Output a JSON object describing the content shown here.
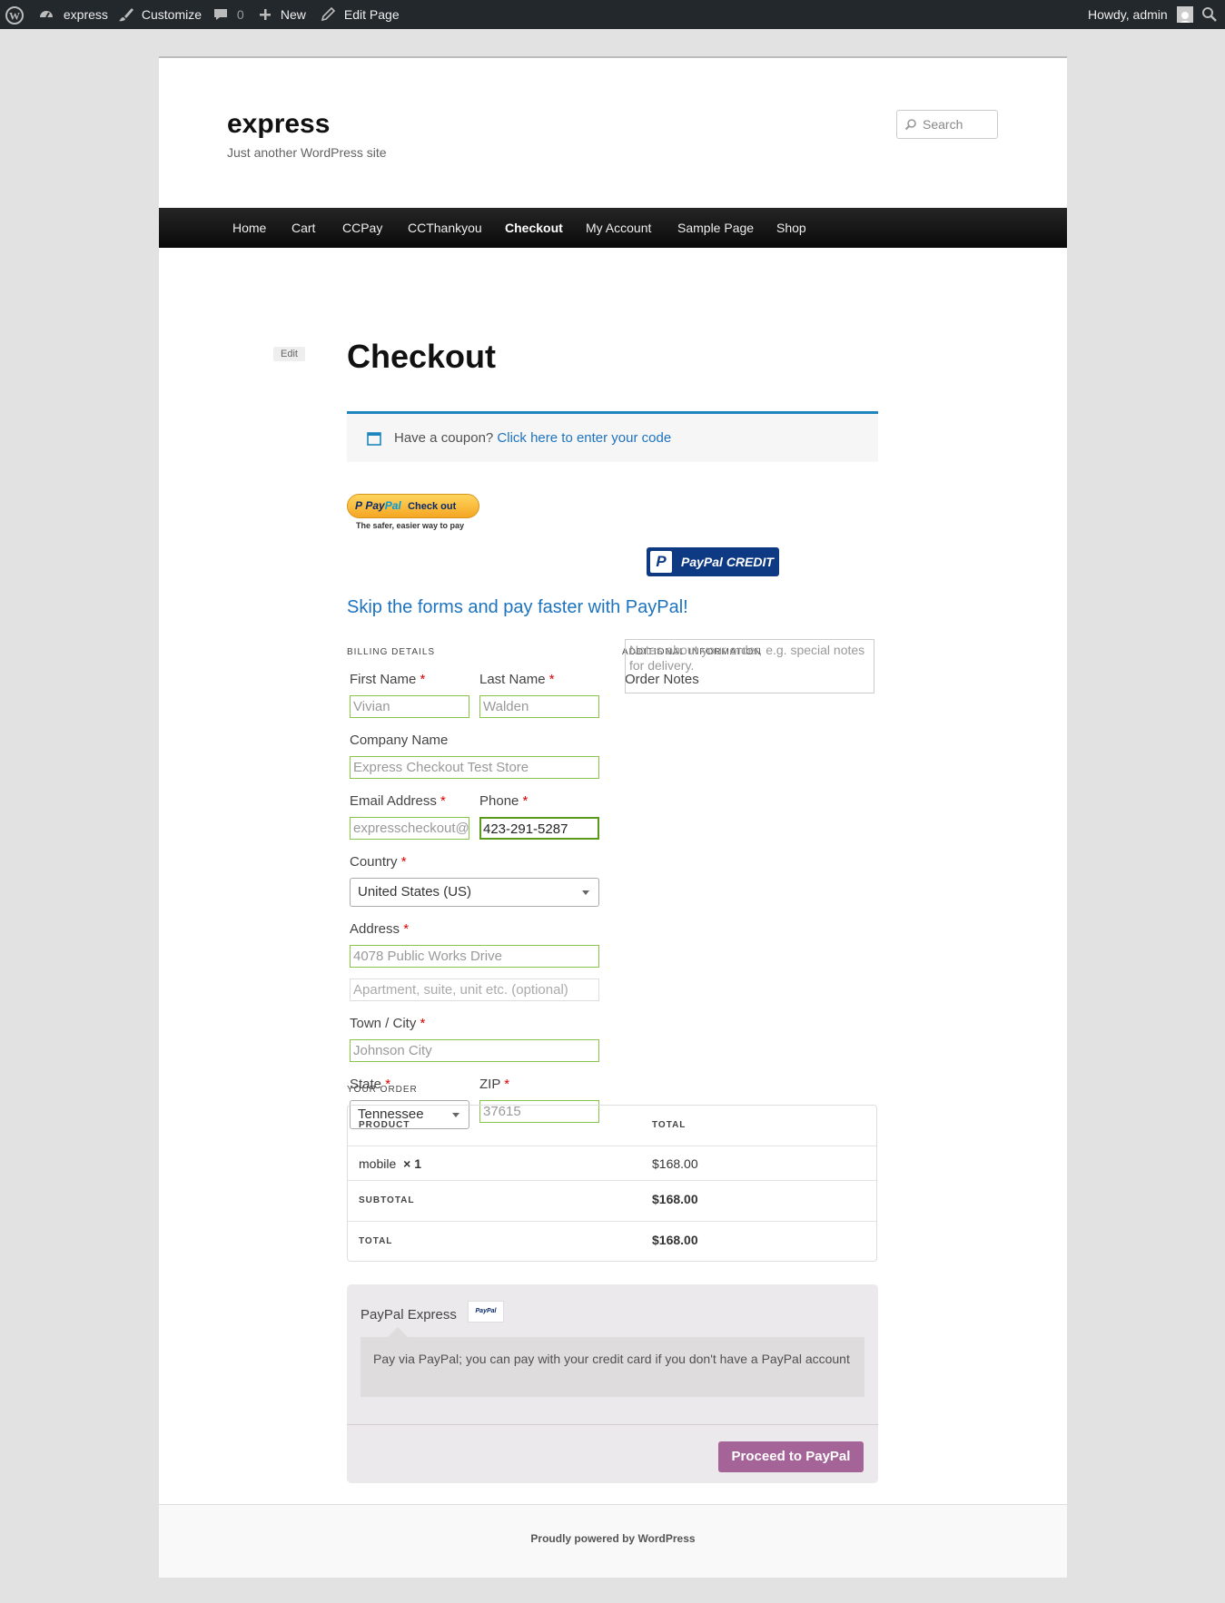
{
  "admin_bar": {
    "site_name": "express",
    "customize": "Customize",
    "comments_count": "0",
    "new": "New",
    "edit_page": "Edit Page",
    "howdy": "Howdy, admin"
  },
  "site": {
    "title": "express",
    "tagline": "Just another WordPress site",
    "search_placeholder": "Search"
  },
  "nav": {
    "items": [
      "Home",
      "Cart",
      "CCPay",
      "CCThankyou",
      "Checkout",
      "My Account",
      "Sample Page",
      "Shop"
    ],
    "active": "Checkout"
  },
  "page": {
    "edit_label": "Edit",
    "title": "Checkout"
  },
  "coupon": {
    "prompt": "Have a coupon?",
    "link": "Click here to enter your code"
  },
  "paypal_buttons": {
    "checkout_pay": "Pay",
    "checkout_pal": "Pal",
    "checkout_label": "Check out",
    "checkout_sub": "The safer, easier way to pay",
    "credit_mark": "P",
    "credit_label": "PayPal CREDIT"
  },
  "skip_text": "Skip the forms and pay faster with PayPal!",
  "billing": {
    "section_title": "Billing Details",
    "first_name": {
      "label": "First Name",
      "value": "Vivian"
    },
    "last_name": {
      "label": "Last Name",
      "value": "Walden"
    },
    "company": {
      "label": "Company Name",
      "value": "Express Checkout Test Store"
    },
    "email": {
      "label": "Email Address",
      "value": "expresscheckout@"
    },
    "phone": {
      "label": "Phone",
      "value": "423-291-5287"
    },
    "country": {
      "label": "Country",
      "value": "United States (US)"
    },
    "address": {
      "label": "Address",
      "value": "4078 Public Works Drive",
      "placeholder2": "Apartment, suite, unit etc. (optional)"
    },
    "city": {
      "label": "Town / City",
      "value": "Johnson City"
    },
    "state": {
      "label": "State",
      "value": "Tennessee"
    },
    "zip": {
      "label": "ZIP",
      "value": "37615"
    },
    "required_mark": "*"
  },
  "additional": {
    "section_title": "Additional Information",
    "notes_label": "Order Notes",
    "notes_placeholder": "Notes about your order, e.g. special notes for delivery."
  },
  "order": {
    "section_title": "Your Order",
    "col_product": "PRODUCT",
    "col_total": "TOTAL",
    "item_name": "mobile",
    "item_qty": "× 1",
    "item_total": "$168.00",
    "subtotal_label": "SUBTOTAL",
    "subtotal": "$168.00",
    "total_label": "TOTAL",
    "total": "$168.00"
  },
  "payment": {
    "method": "PayPal Express",
    "logo_text": "PayPal",
    "description": "Pay via PayPal; you can pay with your credit card if you don't have a PayPal account",
    "button": "Proceed to PayPal"
  },
  "footer": {
    "powered": "Proudly powered by WordPress"
  },
  "colors": {
    "adminbar": "#23282d",
    "link": "#1e73be",
    "button": "#a46497",
    "valid_border": "#8bc34a"
  }
}
